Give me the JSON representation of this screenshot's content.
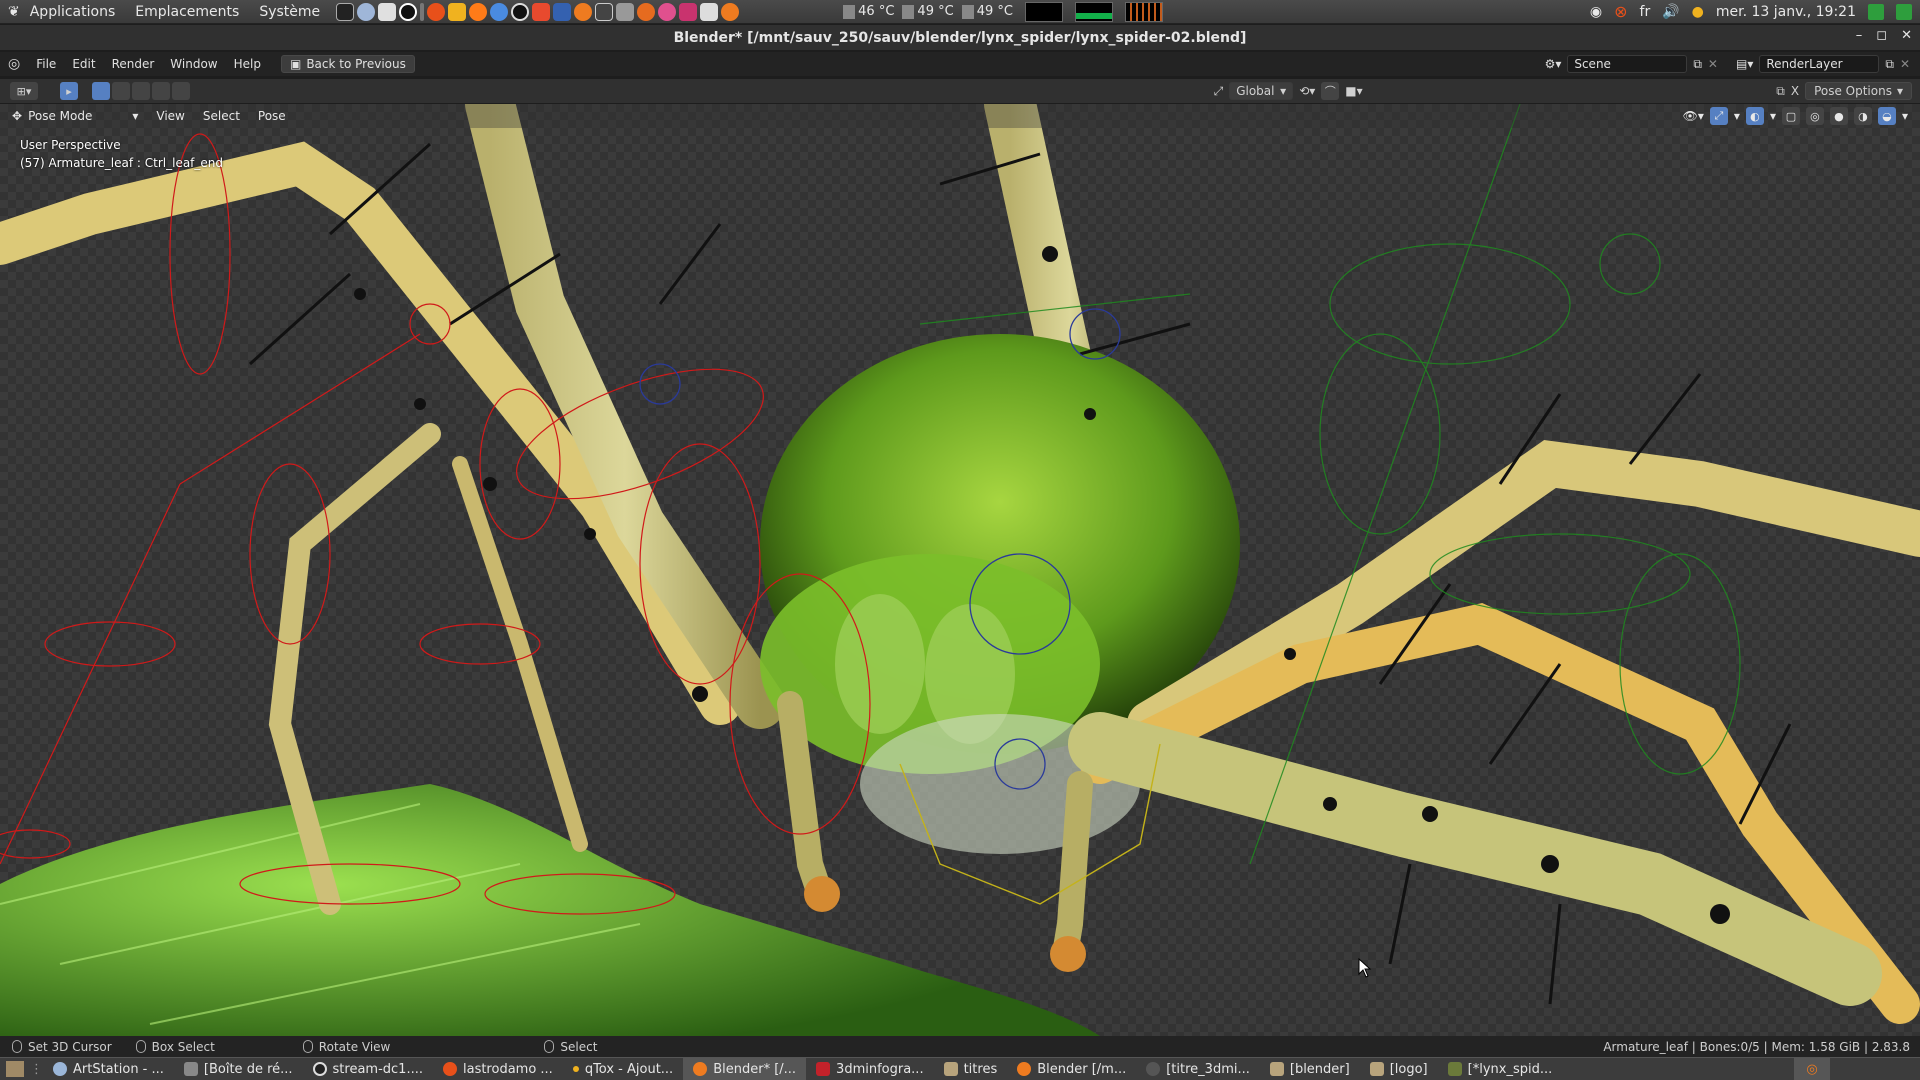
{
  "desktop_panel": {
    "menus": [
      "Applications",
      "Emplacements",
      "Système"
    ],
    "temps": [
      "46 °C",
      "49 °C",
      "49 °C"
    ],
    "keyboard_layout": "fr",
    "clock": "mer. 13 janv., 19:21"
  },
  "window": {
    "title": "Blender* [/mnt/sauv_250/sauv/blender/lynx_spider/lynx_spider-02.blend]"
  },
  "blender_menu": {
    "items": [
      "File",
      "Edit",
      "Render",
      "Window",
      "Help"
    ],
    "back_button": "Back to Previous",
    "scene": "Scene",
    "render_layer": "RenderLayer"
  },
  "tool_header": {
    "orientation": "Global",
    "pose_options": "Pose Options"
  },
  "view_header": {
    "mode": "Pose Mode",
    "menus": [
      "View",
      "Select",
      "Pose"
    ]
  },
  "viewport": {
    "perspective": "User Perspective",
    "active_object": "(57) Armature_leaf : Ctrl_leaf_end"
  },
  "statusbar": {
    "hints": [
      "Set 3D Cursor",
      "Box Select",
      "Rotate View",
      "Select"
    ],
    "info": "Armature_leaf | Bones:0/5 | Mem: 1.58 GiB | 2.83.8"
  },
  "taskbar": {
    "tasks": [
      "ArtStation - ...",
      "[Boîte de ré...",
      "stream-dc1....",
      "lastrodamo ...",
      "qTox - Ajout...",
      "Blender* [/...",
      "3dminfogra...",
      "titres",
      "Blender [/m...",
      "[titre_3dmi...",
      "[blender]",
      "[logo]",
      "[*lynx_spid..."
    ]
  }
}
